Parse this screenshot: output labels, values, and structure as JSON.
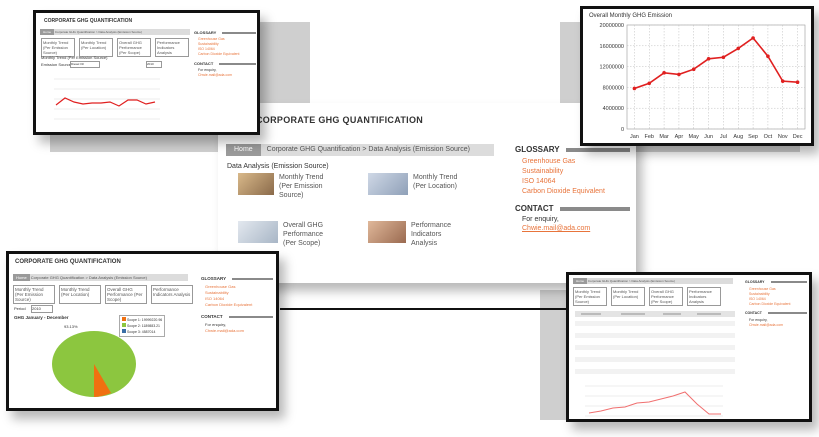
{
  "app_title": "CORPORATE GHG QUANTIFICATION",
  "breadcrumb": {
    "home": "Home",
    "path": "Corporate GHG Quantification > Data Analysis (Emission Source)"
  },
  "section_title": "Data Analysis (Emission Source)",
  "tiles": [
    {
      "label": "Monthly Trend (Per Emission Source)",
      "lines": [
        "Monthly Trend",
        "(Per Emission",
        "Source)"
      ]
    },
    {
      "label": "Monthly Trend (Per Location)",
      "lines": [
        "Monthly Trend",
        "(Per Location)"
      ]
    },
    {
      "label": "Overall GHG Performance (Per Scope)",
      "lines": [
        "Overall GHG",
        "Performance",
        "(Per Scope)"
      ]
    },
    {
      "label": "Performance Indicators Analysis",
      "lines": [
        "Performance",
        "Indicators",
        "Analysis"
      ]
    }
  ],
  "glossary": {
    "title": "GLOSSARY",
    "items": [
      "Greenhouse Gas",
      "Sustainability",
      "ISO 14064",
      "Carbon Dioxide Equivalent"
    ]
  },
  "contact": {
    "title": "CONTACT",
    "text": "For enquiry,",
    "email": "Chwie.mail@ada.com"
  },
  "topleft": {
    "select_label": "Emission Source",
    "select_value": "Diesel Oil",
    "year": "2010",
    "subtitle": "Monthly Trend (Per Emission Source)"
  },
  "bottomleft": {
    "period_label": "Period",
    "period_value": "2010",
    "chart_title": "GHG January - December",
    "pie_pct": "93.13%",
    "legend": [
      "Scope 1: 19999220.96",
      "Scope 2: 1189883.21",
      "Scope 3: 4587014"
    ]
  },
  "chart_data": [
    {
      "type": "line",
      "title": "Overall Monthly GHG Emission",
      "categories": [
        "Jan",
        "Feb",
        "Mar",
        "Apr",
        "May",
        "Jun",
        "Jul",
        "Aug",
        "Sep",
        "Oct",
        "Nov",
        "Dec"
      ],
      "values": [
        7800000,
        8800000,
        10800000,
        10500000,
        11500000,
        13500000,
        13800000,
        15500000,
        17500000,
        14000000,
        9200000,
        9000000
      ],
      "ylim": [
        0,
        20000000
      ],
      "yticks": [
        "0",
        "4000000",
        "8000000",
        "12000000",
        "16000000",
        "20000000"
      ],
      "grid": true,
      "color": "#e02020"
    }
  ]
}
